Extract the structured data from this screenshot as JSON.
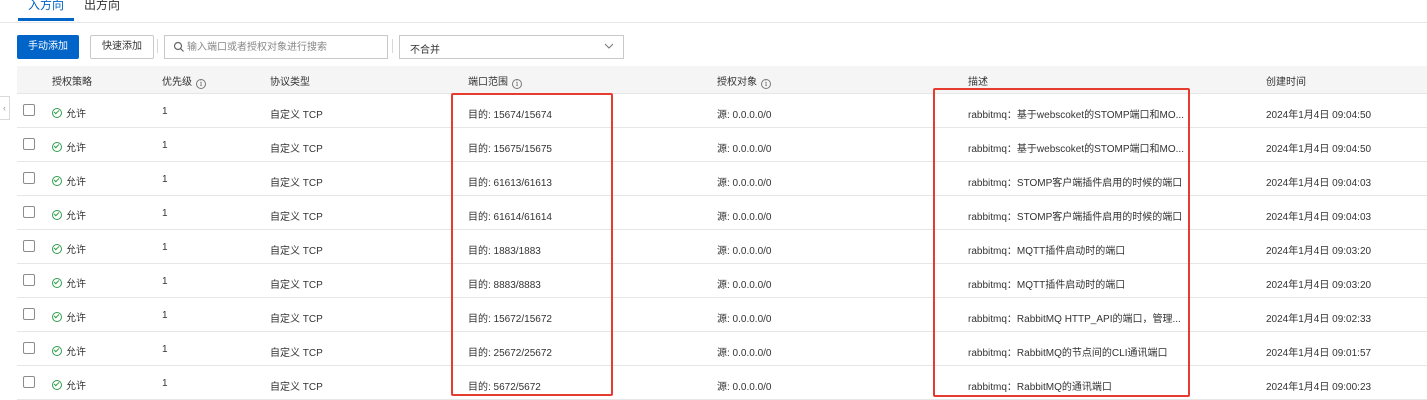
{
  "tabs": {
    "inbound": "入方向",
    "outbound": "出方向"
  },
  "toolbar": {
    "add_manual": "手动添加",
    "add_quick": "快速添加",
    "search_placeholder": "输入端口或者授权对象进行搜索",
    "merge_select": "不合并"
  },
  "table": {
    "headers": {
      "policy": "授权策略",
      "priority": "优先级",
      "protocol": "协议类型",
      "port_range": "端口范围",
      "auth_object": "授权对象",
      "description": "描述",
      "created": "创建时间"
    },
    "rows": [
      {
        "policy": "允许",
        "priority": "1",
        "protocol": "自定义 TCP",
        "port": "目的: 15674/15674",
        "auth": "源: 0.0.0.0/0",
        "desc": "rabbitmq：基于webscoket的STOMP端口和MO...",
        "created": "2024年1月4日 09:04:50"
      },
      {
        "policy": "允许",
        "priority": "1",
        "protocol": "自定义 TCP",
        "port": "目的: 15675/15675",
        "auth": "源: 0.0.0.0/0",
        "desc": "rabbitmq：基于webscoket的STOMP端口和MO...",
        "created": "2024年1月4日 09:04:50"
      },
      {
        "policy": "允许",
        "priority": "1",
        "protocol": "自定义 TCP",
        "port": "目的: 61613/61613",
        "auth": "源: 0.0.0.0/0",
        "desc": "rabbitmq：STOMP客户端插件启用的时候的端口",
        "created": "2024年1月4日 09:04:03"
      },
      {
        "policy": "允许",
        "priority": "1",
        "protocol": "自定义 TCP",
        "port": "目的: 61614/61614",
        "auth": "源: 0.0.0.0/0",
        "desc": "rabbitmq：STOMP客户端插件启用的时候的端口",
        "created": "2024年1月4日 09:04:03"
      },
      {
        "policy": "允许",
        "priority": "1",
        "protocol": "自定义 TCP",
        "port": "目的: 1883/1883",
        "auth": "源: 0.0.0.0/0",
        "desc": "rabbitmq：MQTT插件启动时的端口",
        "created": "2024年1月4日 09:03:20"
      },
      {
        "policy": "允许",
        "priority": "1",
        "protocol": "自定义 TCP",
        "port": "目的: 8883/8883",
        "auth": "源: 0.0.0.0/0",
        "desc": "rabbitmq：MQTT插件启动时的端口",
        "created": "2024年1月4日 09:03:20"
      },
      {
        "policy": "允许",
        "priority": "1",
        "protocol": "自定义 TCP",
        "port": "目的: 15672/15672",
        "auth": "源: 0.0.0.0/0",
        "desc": "rabbitmq：RabbitMQ HTTP_API的端口，管理...",
        "created": "2024年1月4日 09:02:33"
      },
      {
        "policy": "允许",
        "priority": "1",
        "protocol": "自定义 TCP",
        "port": "目的: 25672/25672",
        "auth": "源: 0.0.0.0/0",
        "desc": "rabbitmq：RabbitMQ的节点间的CLI通讯端口",
        "created": "2024年1月4日 09:01:57"
      },
      {
        "policy": "允许",
        "priority": "1",
        "protocol": "自定义 TCP",
        "port": "目的: 5672/5672",
        "auth": "源: 0.0.0.0/0",
        "desc": "rabbitmq：RabbitMQ的通讯端口",
        "created": "2024年1月4日 09:00:23"
      }
    ]
  },
  "icons": {
    "search": "search-icon",
    "chevron": "chevron-down-icon",
    "info": "info-icon",
    "allow": "check-circle-icon",
    "collapse": "chevron-left-icon"
  },
  "colors": {
    "primary": "#0064c8",
    "highlight": "#e53b30",
    "allow": "#2e9e4b",
    "header_bg": "#f5f5f5"
  }
}
